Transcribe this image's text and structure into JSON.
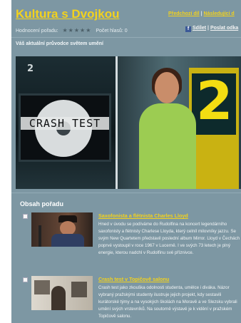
{
  "header": {
    "title": "Kultura s Dvojkou",
    "nav_prev": "Předchozí díl",
    "nav_sep": "|",
    "nav_next": "Následující d",
    "rating_label": "Hodnocení pořadu:",
    "stars": "★★★★★",
    "votes_label": "Počet hlasů: 0",
    "share_label": "Sdílet",
    "share_sep": "|",
    "send_label": "Poslat odka",
    "tagline": "Váš aktuální průvodce světem umění"
  },
  "video": {
    "channel_logo": "2",
    "monitor_text": "CRASH TEST",
    "big_logo": "2"
  },
  "content": {
    "section_title": "Obsah pořadu",
    "items": [
      {
        "title": "Saxofonista a flétnista Charles Lloyd",
        "description": "Hned v úvodu se podíváme do Rudolfina na koncert legendárního saxofonisty a flétnisty Charlese Lloyda, který celníl milovníky jazzu. Se svým New Quartetem představil poslední album Mirror. Lloyd v Čechách poprvé vystoupil v roce 1967 v Lucerně. I ve svých 73 letech je plný energie, kterou nadchl v Rudolfinu své příznivce."
      },
      {
        "title": "Crash test v Topičově salonu",
        "description": "Crash test jako zkouška odolnosti studenta, umělce i diváka. Názor vybraný pražskými studenty ilustruje jejich projekt, kdy sestavili kurátorské týmy a na vysokých školách na Moravě a ve Slezsku vybrali umění svých vrstevníků. Na soutorně výstavě je k vidění v pražském Topičově salonu."
      }
    ]
  },
  "colors": {
    "background": "#7d97a3",
    "accent": "#f3d21c",
    "text": "#f1f4f5"
  }
}
